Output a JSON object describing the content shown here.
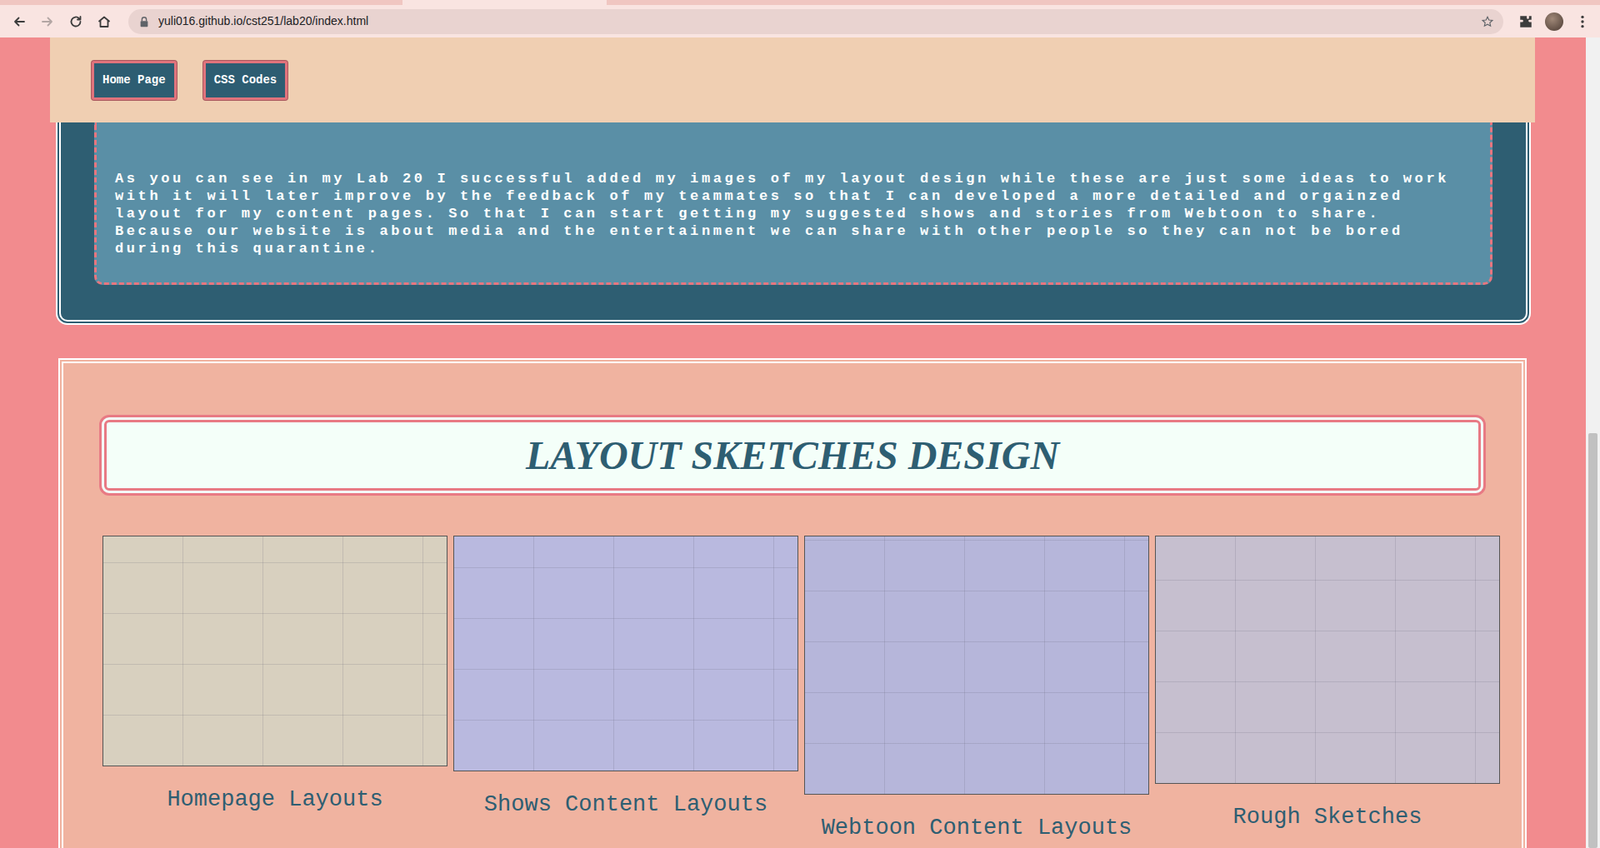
{
  "browser": {
    "url": "yuli016.github.io/cst251/lab20/index.html",
    "toolbar": [
      {
        "kind": "back",
        "disabled": false
      },
      {
        "kind": "forward",
        "disabled": true
      },
      {
        "kind": "reload",
        "disabled": false
      },
      {
        "kind": "home",
        "disabled": false
      }
    ]
  },
  "nav": {
    "buttons": [
      "Home Page",
      "CSS Codes"
    ]
  },
  "intro": {
    "text": "As you can see in my Lab 20 I successful added my images of my layout design while these are just some ideas to work with it will later improve by the feedback of my teammates so that I can developed a more detailed and orgainzed layout for my content pages. So that I can start getting my suggested shows and stories from Webtoon to share. Because our website is about media and the entertainment we can share with other people so they can not be bored during this quarantine."
  },
  "gallery": {
    "title": "LAYOUT SKETCHES DESIGN",
    "items": [
      {
        "caption": "Homepage Layouts"
      },
      {
        "caption": "Shows Content Layouts"
      },
      {
        "caption": "Webtoon Content Layouts"
      },
      {
        "caption": "Rough Sketches"
      }
    ]
  }
}
